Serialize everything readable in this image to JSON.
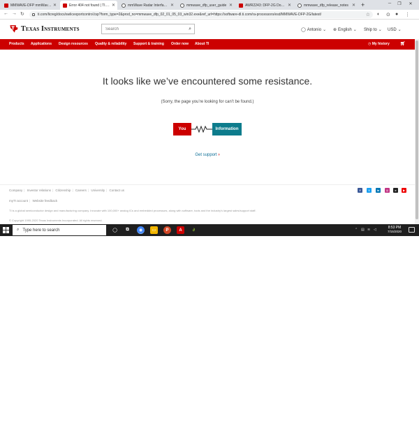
{
  "browser": {
    "tabs": [
      {
        "label": "MMWAVE-DFP mmWave de",
        "favicon": "ti"
      },
      {
        "label": "Error 404 not found | TI.com",
        "favicon": "ti",
        "active": true
      },
      {
        "label": "mmWave Radar Interface Co",
        "favicon": "globe"
      },
      {
        "label": "mmwave_dfp_user_guide",
        "favicon": "globe"
      },
      {
        "label": "AWR2243: DFP-2G Downlo",
        "favicon": "ti"
      },
      {
        "label": "mmwave_dfp_release_notes",
        "favicon": "globe"
      }
    ],
    "new_tab_label": "+",
    "url": "ti.com/licreg/docs/swlicexportcontrol.tsp?form_type=2&prod_no=mmwave_dfp_02_01_05_03_win32.exe&ref_url=https://software-dl.ti.com/ra-processors/esd/MMWAVE-DFP-2G/latest/"
  },
  "header": {
    "logo_text": "Texas Instruments",
    "search_placeholder": "Search",
    "user": "Antonio",
    "language": "English",
    "ship_to": "Ship to",
    "currency": "USD"
  },
  "nav": {
    "items": [
      "Products",
      "Applications",
      "Design resources",
      "Quality & reliability",
      "Support & training",
      "Order now",
      "About TI"
    ],
    "history": "My history"
  },
  "main": {
    "headline": "It looks like we’ve encountered some resistance.",
    "subline": "(Sorry, the page you’re looking for can’t be found.)",
    "you_label": "You",
    "info_label": "Information",
    "support_link": "Get support"
  },
  "footer": {
    "links": [
      "Company",
      "Investor relations",
      "Citizenship",
      "Careers",
      "University",
      "Contact us"
    ],
    "links2": [
      "myTI account",
      "Website feedback"
    ],
    "description": "TI is a global semiconductor design and manufacturing company. Innovate with 100,000+ analog ICs and embedded processors, along with software, tools and the industry’s largest sales/support staff.",
    "copyright": "© Copyright 1995-2020   Texas Instruments Incorporated. All rights reserved."
  },
  "taskbar": {
    "search_text": "Type here to search",
    "time": "8:53 PM",
    "date": "7/15/2020"
  },
  "colors": {
    "ti_red": "#cc0000",
    "info_teal": "#0d7c8c",
    "link_blue": "#0d6e96"
  }
}
